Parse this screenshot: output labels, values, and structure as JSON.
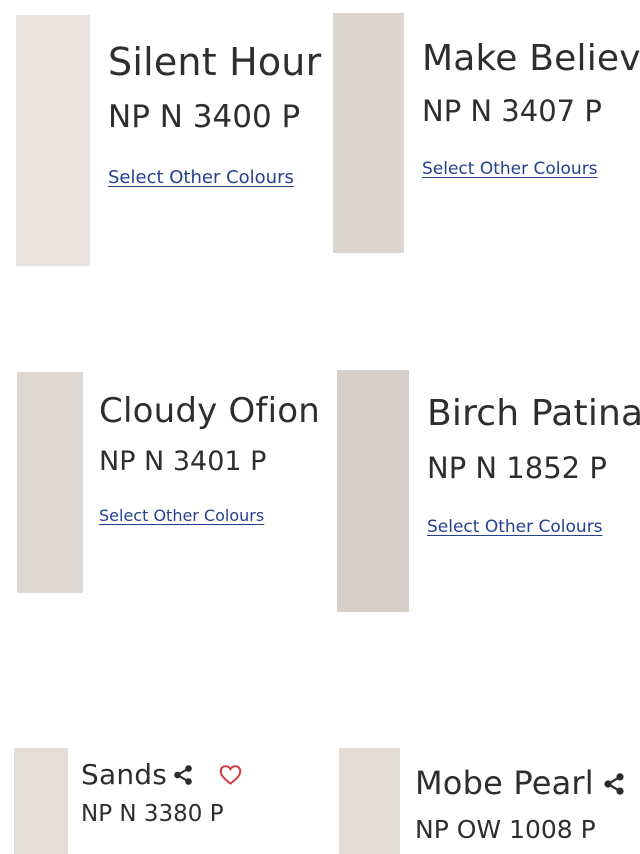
{
  "colours": [
    {
      "name": "Silent Hour",
      "code": "NP N 3400 P",
      "link": "Select Other Colours",
      "swatch": "#e9e4df"
    },
    {
      "name": "Make Believe",
      "code": "NP N 3407 P",
      "link": "Select Other Colours",
      "swatch": "#dcd5cd"
    },
    {
      "name": "Cloudy Ofion",
      "code": "NP N 3401 P",
      "link": "Select Other Colours",
      "swatch": "#dfd9d3"
    },
    {
      "name": "Birch Patina",
      "code": "NP N 1852 P",
      "link": "Select Other Colours",
      "swatch": "#d7d0c8"
    },
    {
      "name": "Sands",
      "code": "NP N 3380 P",
      "swatch": "#e4ded7",
      "icons": [
        "share-icon",
        "heart-icon"
      ]
    },
    {
      "name": "Mobe Pearl",
      "code": "NP OW 1008 P",
      "swatch": "#e2dcd3",
      "icons": [
        "share-icon"
      ]
    }
  ],
  "colors": {
    "link": "#25408f",
    "heart": "#d7323e",
    "text": "#2e2e2e"
  }
}
